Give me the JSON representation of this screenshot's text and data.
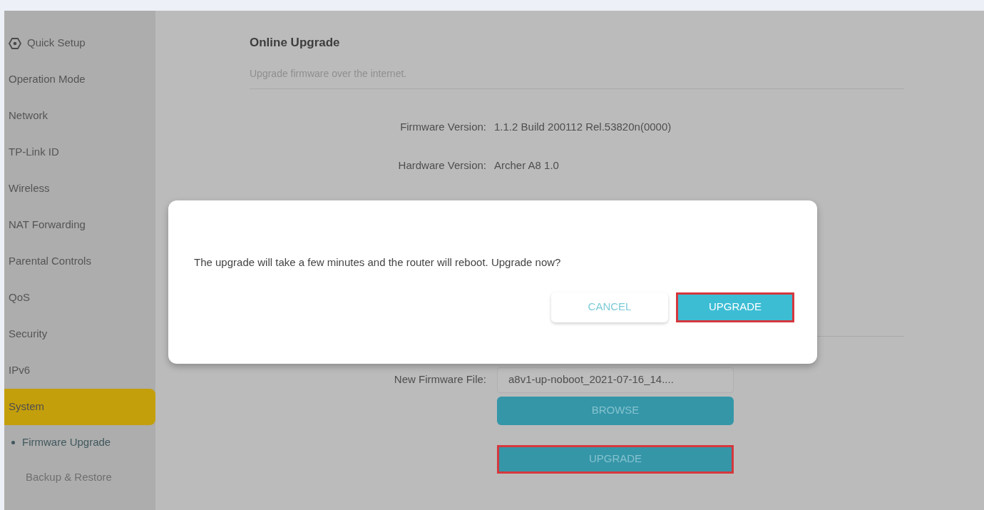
{
  "sidebar": {
    "items": [
      {
        "label": "Quick Setup",
        "kind": "icon",
        "selected": false
      },
      {
        "label": "Operation Mode",
        "kind": "plain",
        "selected": false
      },
      {
        "label": "Network",
        "kind": "plain",
        "selected": false
      },
      {
        "label": "TP-Link ID",
        "kind": "plain",
        "selected": false
      },
      {
        "label": "Wireless",
        "kind": "plain",
        "selected": false
      },
      {
        "label": "NAT Forwarding",
        "kind": "plain",
        "selected": false
      },
      {
        "label": "Parental Controls",
        "kind": "plain",
        "selected": false
      },
      {
        "label": "QoS",
        "kind": "plain",
        "selected": false
      },
      {
        "label": "Security",
        "kind": "plain",
        "selected": false
      },
      {
        "label": "IPv6",
        "kind": "plain",
        "selected": false
      },
      {
        "label": "System",
        "kind": "plain",
        "selected": true,
        "children": [
          {
            "label": "Firmware Upgrade",
            "selected": true
          },
          {
            "label": "Backup & Restore",
            "selected": false
          }
        ]
      }
    ]
  },
  "section": {
    "title": "Online Upgrade",
    "subtitle": "Upgrade firmware over the internet.",
    "info": [
      {
        "label": "Firmware Version:",
        "value": "1.1.2 Build 200112 Rel.53820n(0000)"
      },
      {
        "label": "Hardware Version:",
        "value": "Archer A8 1.0"
      }
    ]
  },
  "local": {
    "file_label": "New Firmware File:",
    "file_value": "a8v1-up-noboot_2021-07-16_14....",
    "buttons": [
      {
        "label": "BROWSE",
        "highlighted": false
      },
      {
        "label": "UPGRADE",
        "highlighted": true
      }
    ]
  },
  "dialog": {
    "message": "The upgrade will take a few minutes and the router will reboot. Upgrade now?",
    "buttons": [
      {
        "label": "CANCEL",
        "kind": "secondary",
        "highlighted": false
      },
      {
        "label": "UPGRADE",
        "kind": "primary",
        "highlighted": true
      }
    ]
  }
}
